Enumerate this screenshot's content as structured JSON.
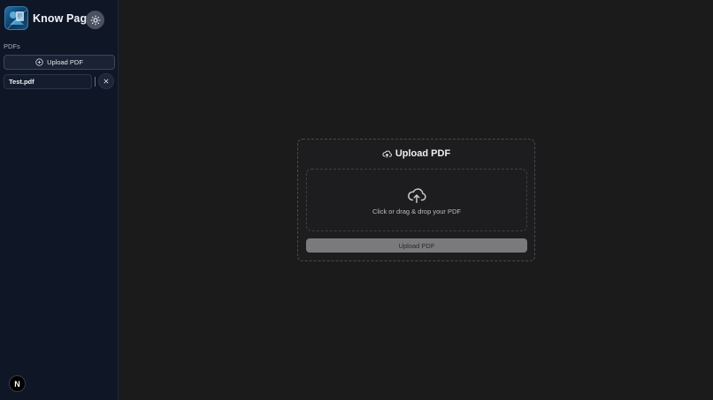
{
  "brand": {
    "name": "Know Page"
  },
  "sidebar": {
    "section_label": "PDFs",
    "upload_button_label": "Upload PDF",
    "files": [
      {
        "name": "Test.pdf"
      }
    ]
  },
  "footer": {
    "badge_letter": "N"
  },
  "main": {
    "card_title": "Upload PDF",
    "dropzone_text": "Click or drag & drop your PDF",
    "submit_label": "Upload PDF"
  },
  "colors": {
    "sidebar_bg": "#0f1727",
    "main_bg": "#1b1b1c",
    "disabled_button": "#7a7a7c"
  }
}
